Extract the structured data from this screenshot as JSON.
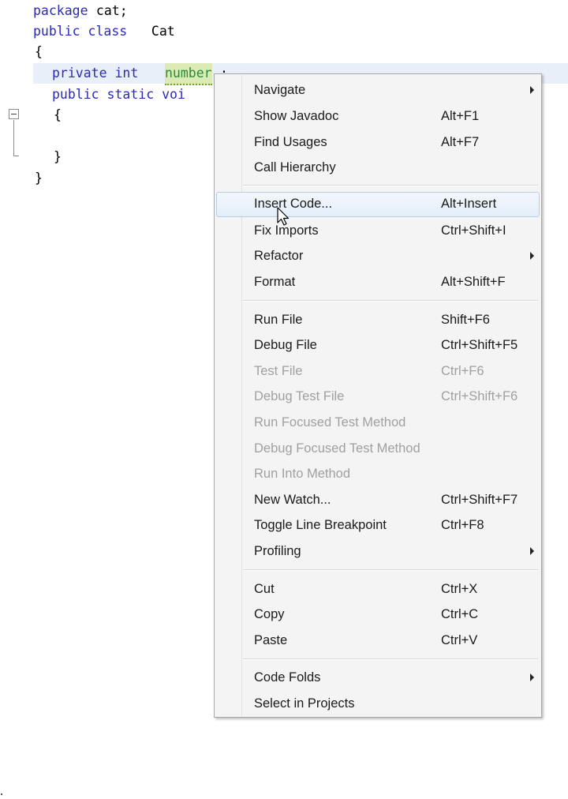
{
  "editor": {
    "lines": [
      {
        "a": "package",
        "b": " cat;"
      },
      {
        "a": "public class",
        "b": " Cat"
      },
      {
        "a": "{"
      },
      {
        "a": "private int",
        "b": "number",
        "c": ";"
      },
      {
        "a": "public static voi"
      },
      {
        "a": "{"
      },
      {
        "a": "}"
      },
      {
        "a": "}"
      }
    ]
  },
  "menu": {
    "items": [
      {
        "label": "Navigate",
        "shortcut": ""
      },
      {
        "label": "Show Javadoc",
        "shortcut": "Alt+F1"
      },
      {
        "label": "Find Usages",
        "shortcut": "Alt+F7"
      },
      {
        "label": "Call Hierarchy",
        "shortcut": ""
      },
      {
        "label": "Insert Code...",
        "shortcut": "Alt+Insert"
      },
      {
        "label": "Fix Imports",
        "shortcut": "Ctrl+Shift+I"
      },
      {
        "label": "Refactor",
        "shortcut": ""
      },
      {
        "label": "Format",
        "shortcut": "Alt+Shift+F"
      },
      {
        "label": "Run File",
        "shortcut": "Shift+F6"
      },
      {
        "label": "Debug File",
        "shortcut": "Ctrl+Shift+F5"
      },
      {
        "label": "Test File",
        "shortcut": "Ctrl+F6"
      },
      {
        "label": "Debug Test File",
        "shortcut": "Ctrl+Shift+F6"
      },
      {
        "label": "Run Focused Test Method",
        "shortcut": ""
      },
      {
        "label": "Debug Focused Test Method",
        "shortcut": ""
      },
      {
        "label": "Run Into Method",
        "shortcut": ""
      },
      {
        "label": "New Watch...",
        "shortcut": "Ctrl+Shift+F7"
      },
      {
        "label": "Toggle Line Breakpoint",
        "shortcut": "Ctrl+F8"
      },
      {
        "label": "Profiling",
        "shortcut": ""
      },
      {
        "label": "Cut",
        "shortcut": "Ctrl+X"
      },
      {
        "label": "Copy",
        "shortcut": "Ctrl+C"
      },
      {
        "label": "Paste",
        "shortcut": "Ctrl+V"
      },
      {
        "label": "Code Folds",
        "shortcut": ""
      },
      {
        "label": "Select in Projects",
        "shortcut": ""
      }
    ],
    "selected_item": "Insert Code...",
    "disabled_items": [
      "Test File",
      "Debug Test File",
      "Run Focused Test Method",
      "Debug Focused Test Method",
      "Run Into Method"
    ],
    "submenu_items": [
      "Navigate",
      "Refactor",
      "Profiling",
      "Code Folds"
    ]
  },
  "colors": {
    "keyword": "#2a2ab8",
    "field_highlight": "#dcebb5",
    "current_line": "#e9eff8",
    "menu_background": "#f4f4f4",
    "selection_border": "#b6cde8"
  },
  "icons": [
    "fold-collapse-icon",
    "submenu-arrow-icon",
    "mouse-pointer-icon"
  ]
}
